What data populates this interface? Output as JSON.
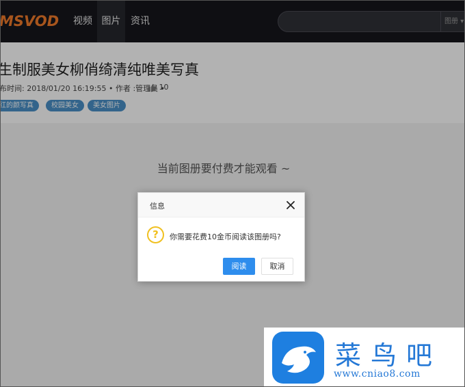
{
  "nav": {
    "logo": "MSVOD",
    "items": [
      {
        "label": "视频",
        "active": false
      },
      {
        "label": "图片",
        "active": true
      },
      {
        "label": "资讯",
        "active": false
      }
    ],
    "search": {
      "placeholder": "",
      "type_label": "图册"
    }
  },
  "article": {
    "title": "生制服美女柳俏绮清纯唯美写真",
    "meta": "布时间: 2018/01/20 16:19:55 • 作者 :管理员 •",
    "likes": "10",
    "tags": [
      "红的颜写真",
      "校园美女",
      "美女图片"
    ]
  },
  "content": {
    "paywall_text": "当前图册要付费才能观看 ~"
  },
  "dialog": {
    "title": "信息",
    "icon": "?",
    "message": "你需要花费10金币阅读该图册吗?",
    "confirm_label": "阅读",
    "cancel_label": "取消"
  },
  "watermark": {
    "name": "菜鸟吧",
    "url": "www.cniao8.com"
  },
  "colors": {
    "nav_bg": "#16161c",
    "logo": "#f07a2a",
    "tag_bg": "#4a90c8",
    "primary_button": "#2e8ded",
    "question_icon": "#f0c020",
    "watermark": "#2478d6"
  }
}
